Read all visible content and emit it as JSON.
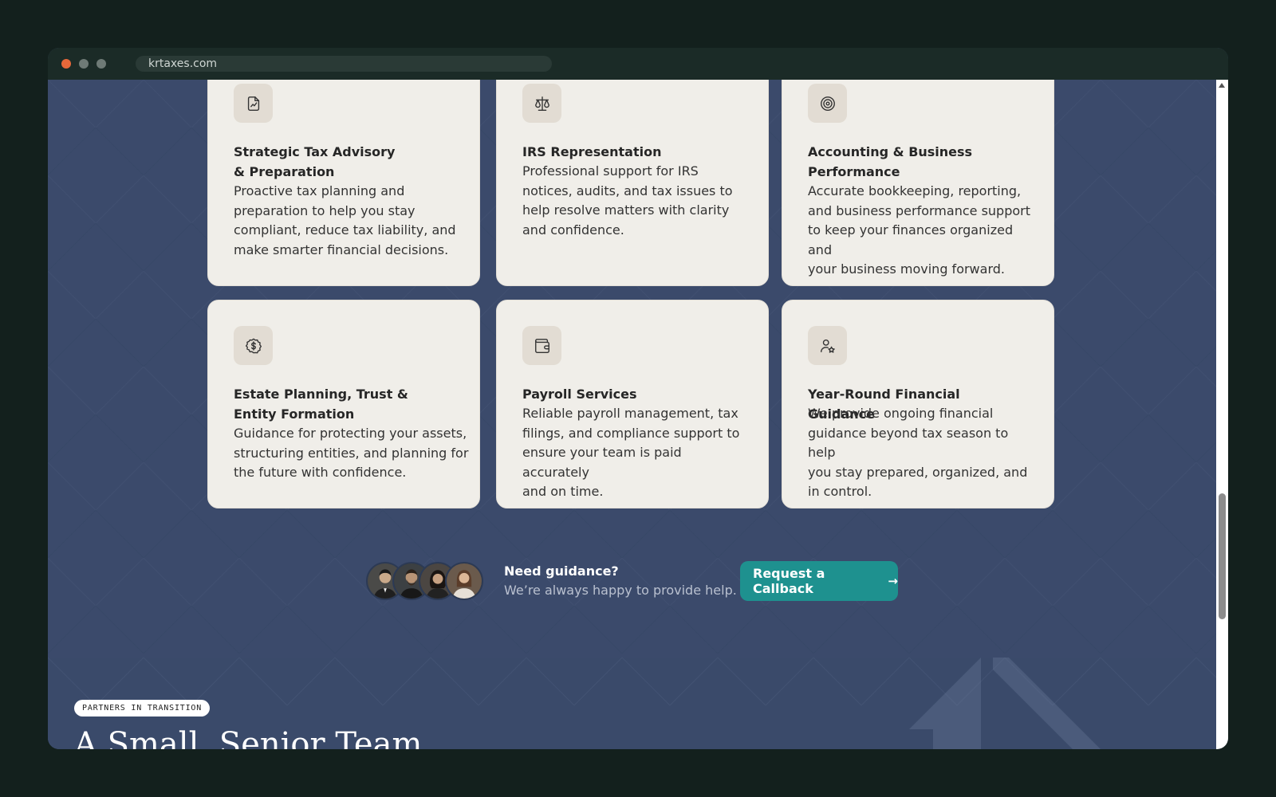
{
  "browser": {
    "url": "krtaxes.com"
  },
  "services": [
    {
      "icon": "document-chart-icon",
      "title_lines": [
        "Strategic Tax Advisory",
        "& Preparation"
      ],
      "description_lines": [
        "Proactive tax planning and",
        "preparation to help you stay",
        "compliant, reduce tax liability, and",
        "make smarter financial decisions."
      ]
    },
    {
      "icon": "scales-icon",
      "title_lines": [
        "IRS Representation"
      ],
      "description_lines": [
        "Professional support for IRS",
        "notices, audits, and tax issues to",
        "help resolve matters with clarity",
        "and confidence."
      ]
    },
    {
      "icon": "target-icon",
      "title_lines": [
        "Accounting & Business",
        "Performance"
      ],
      "description_lines": [
        "Accurate bookkeeping, reporting,",
        "and business performance support",
        "to keep your finances organized and",
        "your business moving forward."
      ]
    },
    {
      "icon": "dollar-badge-icon",
      "title_lines": [
        "Estate Planning, Trust &",
        "Entity Formation"
      ],
      "description_lines": [
        "Guidance for protecting your assets,",
        "structuring entities, and planning for",
        "the future with confidence."
      ]
    },
    {
      "icon": "wallet-icon",
      "title_lines": [
        "Payroll Services"
      ],
      "description_lines": [
        "Reliable payroll management, tax",
        "filings, and compliance support to",
        "ensure your team is paid accurately",
        "and on time."
      ]
    },
    {
      "icon": "user-star-icon",
      "title_lines": [
        "Year-Round Financial Guidance"
      ],
      "description_lines": [
        "We provide ongoing financial",
        "guidance beyond tax season to help",
        "you stay prepared, organized, and",
        "in control."
      ]
    }
  ],
  "guidance": {
    "title": "Need guidance?",
    "subtitle": "We’re always happy to provide help.",
    "cta_label": "Request a Callback",
    "cta_arrow": "→"
  },
  "team_section": {
    "eyebrow": "PARTNERS IN TRANSITION",
    "title": "A Small, Senior Team"
  },
  "colors": {
    "page_bg": "#3b4a6b",
    "card_bg": "#f0eee9",
    "accent": "#1e918f"
  }
}
